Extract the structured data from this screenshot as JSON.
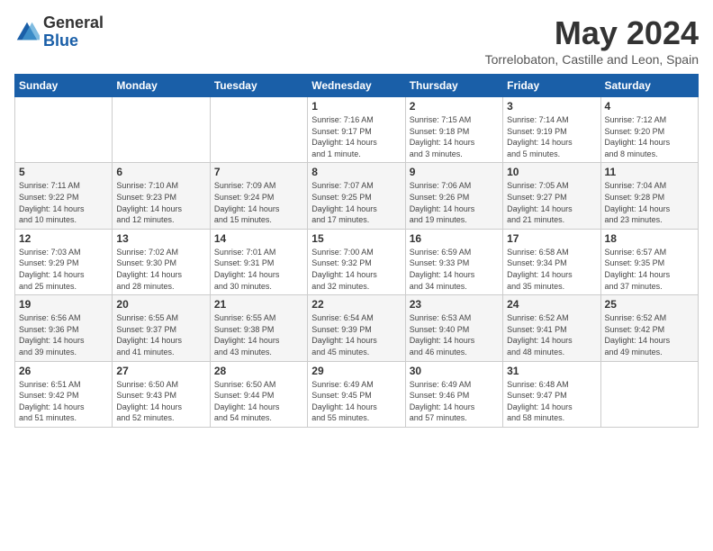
{
  "header": {
    "logo_general": "General",
    "logo_blue": "Blue",
    "month_title": "May 2024",
    "location": "Torrelobaton, Castille and Leon, Spain"
  },
  "weekdays": [
    "Sunday",
    "Monday",
    "Tuesday",
    "Wednesday",
    "Thursday",
    "Friday",
    "Saturday"
  ],
  "weeks": [
    [
      {
        "day": "",
        "content": ""
      },
      {
        "day": "",
        "content": ""
      },
      {
        "day": "",
        "content": ""
      },
      {
        "day": "1",
        "content": "Sunrise: 7:16 AM\nSunset: 9:17 PM\nDaylight: 14 hours\nand 1 minute."
      },
      {
        "day": "2",
        "content": "Sunrise: 7:15 AM\nSunset: 9:18 PM\nDaylight: 14 hours\nand 3 minutes."
      },
      {
        "day": "3",
        "content": "Sunrise: 7:14 AM\nSunset: 9:19 PM\nDaylight: 14 hours\nand 5 minutes."
      },
      {
        "day": "4",
        "content": "Sunrise: 7:12 AM\nSunset: 9:20 PM\nDaylight: 14 hours\nand 8 minutes."
      }
    ],
    [
      {
        "day": "5",
        "content": "Sunrise: 7:11 AM\nSunset: 9:22 PM\nDaylight: 14 hours\nand 10 minutes."
      },
      {
        "day": "6",
        "content": "Sunrise: 7:10 AM\nSunset: 9:23 PM\nDaylight: 14 hours\nand 12 minutes."
      },
      {
        "day": "7",
        "content": "Sunrise: 7:09 AM\nSunset: 9:24 PM\nDaylight: 14 hours\nand 15 minutes."
      },
      {
        "day": "8",
        "content": "Sunrise: 7:07 AM\nSunset: 9:25 PM\nDaylight: 14 hours\nand 17 minutes."
      },
      {
        "day": "9",
        "content": "Sunrise: 7:06 AM\nSunset: 9:26 PM\nDaylight: 14 hours\nand 19 minutes."
      },
      {
        "day": "10",
        "content": "Sunrise: 7:05 AM\nSunset: 9:27 PM\nDaylight: 14 hours\nand 21 minutes."
      },
      {
        "day": "11",
        "content": "Sunrise: 7:04 AM\nSunset: 9:28 PM\nDaylight: 14 hours\nand 23 minutes."
      }
    ],
    [
      {
        "day": "12",
        "content": "Sunrise: 7:03 AM\nSunset: 9:29 PM\nDaylight: 14 hours\nand 25 minutes."
      },
      {
        "day": "13",
        "content": "Sunrise: 7:02 AM\nSunset: 9:30 PM\nDaylight: 14 hours\nand 28 minutes."
      },
      {
        "day": "14",
        "content": "Sunrise: 7:01 AM\nSunset: 9:31 PM\nDaylight: 14 hours\nand 30 minutes."
      },
      {
        "day": "15",
        "content": "Sunrise: 7:00 AM\nSunset: 9:32 PM\nDaylight: 14 hours\nand 32 minutes."
      },
      {
        "day": "16",
        "content": "Sunrise: 6:59 AM\nSunset: 9:33 PM\nDaylight: 14 hours\nand 34 minutes."
      },
      {
        "day": "17",
        "content": "Sunrise: 6:58 AM\nSunset: 9:34 PM\nDaylight: 14 hours\nand 35 minutes."
      },
      {
        "day": "18",
        "content": "Sunrise: 6:57 AM\nSunset: 9:35 PM\nDaylight: 14 hours\nand 37 minutes."
      }
    ],
    [
      {
        "day": "19",
        "content": "Sunrise: 6:56 AM\nSunset: 9:36 PM\nDaylight: 14 hours\nand 39 minutes."
      },
      {
        "day": "20",
        "content": "Sunrise: 6:55 AM\nSunset: 9:37 PM\nDaylight: 14 hours\nand 41 minutes."
      },
      {
        "day": "21",
        "content": "Sunrise: 6:55 AM\nSunset: 9:38 PM\nDaylight: 14 hours\nand 43 minutes."
      },
      {
        "day": "22",
        "content": "Sunrise: 6:54 AM\nSunset: 9:39 PM\nDaylight: 14 hours\nand 45 minutes."
      },
      {
        "day": "23",
        "content": "Sunrise: 6:53 AM\nSunset: 9:40 PM\nDaylight: 14 hours\nand 46 minutes."
      },
      {
        "day": "24",
        "content": "Sunrise: 6:52 AM\nSunset: 9:41 PM\nDaylight: 14 hours\nand 48 minutes."
      },
      {
        "day": "25",
        "content": "Sunrise: 6:52 AM\nSunset: 9:42 PM\nDaylight: 14 hours\nand 49 minutes."
      }
    ],
    [
      {
        "day": "26",
        "content": "Sunrise: 6:51 AM\nSunset: 9:42 PM\nDaylight: 14 hours\nand 51 minutes."
      },
      {
        "day": "27",
        "content": "Sunrise: 6:50 AM\nSunset: 9:43 PM\nDaylight: 14 hours\nand 52 minutes."
      },
      {
        "day": "28",
        "content": "Sunrise: 6:50 AM\nSunset: 9:44 PM\nDaylight: 14 hours\nand 54 minutes."
      },
      {
        "day": "29",
        "content": "Sunrise: 6:49 AM\nSunset: 9:45 PM\nDaylight: 14 hours\nand 55 minutes."
      },
      {
        "day": "30",
        "content": "Sunrise: 6:49 AM\nSunset: 9:46 PM\nDaylight: 14 hours\nand 57 minutes."
      },
      {
        "day": "31",
        "content": "Sunrise: 6:48 AM\nSunset: 9:47 PM\nDaylight: 14 hours\nand 58 minutes."
      },
      {
        "day": "",
        "content": ""
      }
    ]
  ]
}
